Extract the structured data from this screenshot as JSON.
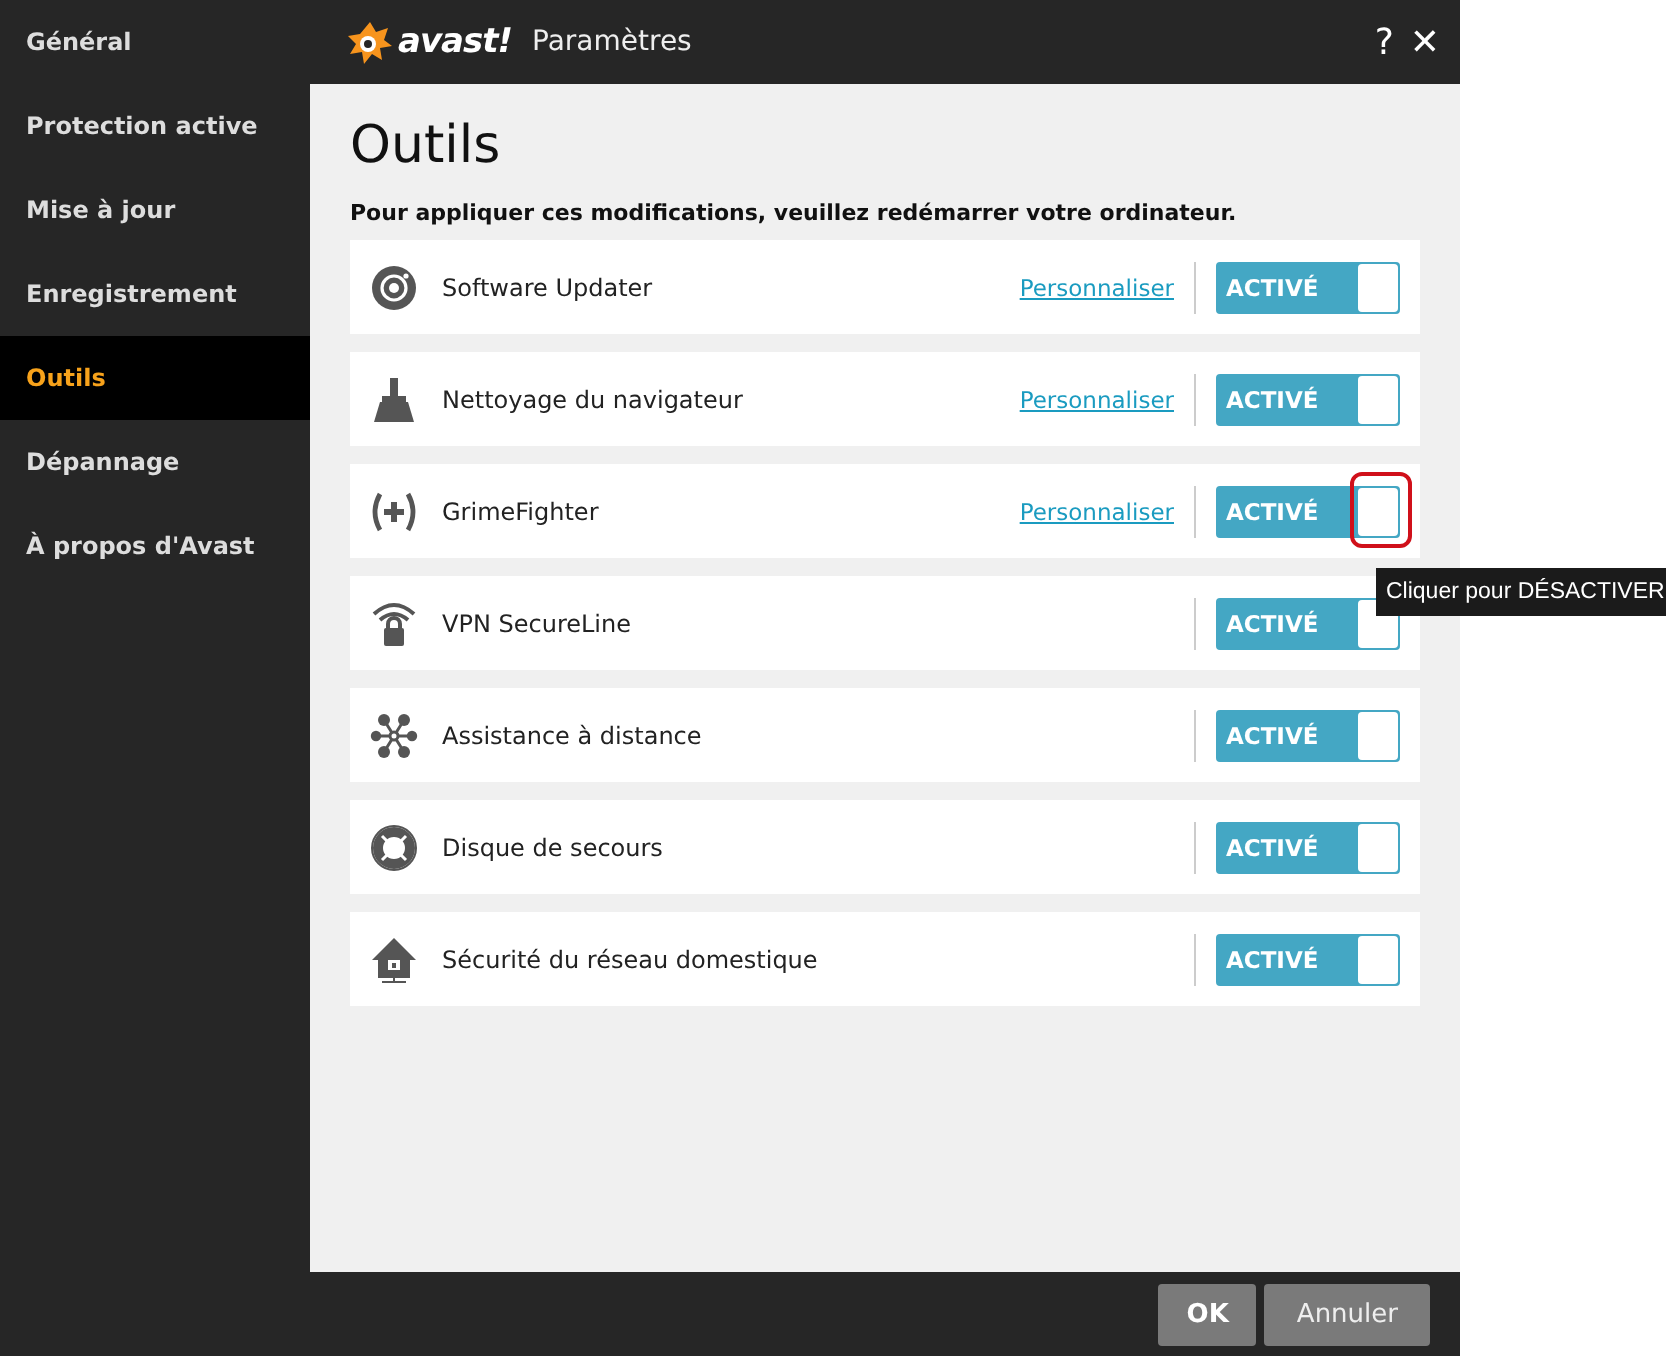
{
  "sidebar": {
    "items": [
      {
        "label": "Général",
        "selected": false
      },
      {
        "label": "Protection active",
        "selected": false
      },
      {
        "label": "Mise à jour",
        "selected": false
      },
      {
        "label": "Enregistrement",
        "selected": false
      },
      {
        "label": "Outils",
        "selected": true
      },
      {
        "label": "Dépannage",
        "selected": false
      },
      {
        "label": "À propos d'Avast",
        "selected": false
      }
    ]
  },
  "title_bar": {
    "logo_text": "avast!",
    "title": "Paramètres",
    "help": "?",
    "close": "✕"
  },
  "page": {
    "heading": "Outils",
    "notice": "Pour appliquer ces modifications, veuillez redémarrer votre ordinateur."
  },
  "tools": [
    {
      "kind": "updater",
      "name": "Software Updater",
      "link": "Personnaliser",
      "toggle": "ACTIVÉ",
      "on": true,
      "highlighted": false
    },
    {
      "kind": "broom",
      "name": "Nettoyage du navigateur",
      "link": "Personnaliser",
      "toggle": "ACTIVÉ",
      "on": true,
      "highlighted": false
    },
    {
      "kind": "plus",
      "name": "GrimeFighter",
      "link": "Personnaliser",
      "toggle": "ACTIVÉ",
      "on": true,
      "highlighted": true
    },
    {
      "kind": "vpn",
      "name": "VPN SecureLine",
      "toggle": "ACTIVÉ",
      "on": true,
      "highlighted": false
    },
    {
      "kind": "network",
      "name": "Assistance à distance",
      "toggle": "ACTIVÉ",
      "on": true,
      "highlighted": false
    },
    {
      "kind": "lifebuoy",
      "name": "Disque de secours",
      "toggle": "ACTIVÉ",
      "on": true,
      "highlighted": false
    },
    {
      "kind": "house",
      "name": "Sécurité du réseau domestique",
      "toggle": "ACTIVÉ",
      "on": true,
      "highlighted": false
    }
  ],
  "tooltip": {
    "text": "Cliquer pour DÉSACTIVER"
  },
  "buttons": [
    {
      "label": "OK",
      "kind": "primary"
    },
    {
      "label": "Annuler",
      "kind": "secondary"
    }
  ]
}
